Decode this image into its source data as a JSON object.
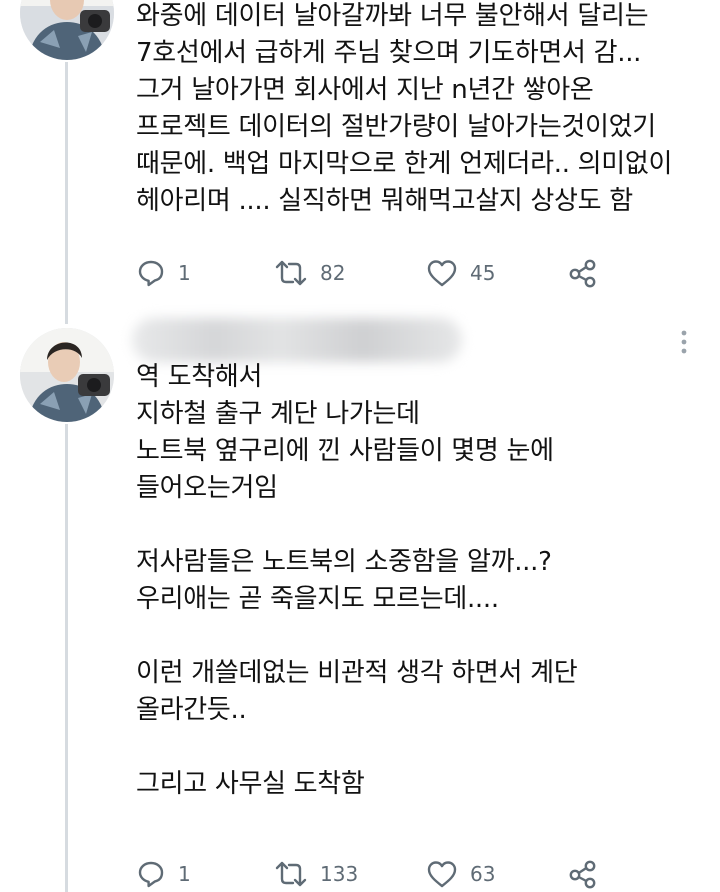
{
  "tweets": [
    {
      "author_name": "",
      "text": "와중에 데이터 날아갈까봐 너무 불안해서 달리는\n7호선에서 급하게 주님 찾으며 기도하면서 감...\n그거 날아가면 회사에서 지난 n년간 쌓아온\n프로젝트 데이터의 절반가량이 날아가는것이었기\n때문에. 백업 마지막으로 한게 언제더라.. 의미없이\n헤아리며 .... 실직하면 뭐해먹고살지 상상도 함",
      "replies": "1",
      "retweets": "82",
      "likes": "45"
    },
    {
      "author_name": "",
      "text": "역 도착해서\n지하철 출구 계단 나가는데\n노트북 옆구리에 낀 사람들이 몇명 눈에\n들어오는거임\n\n저사람들은 노트북의 소중함을 알까...?\n우리애는 곧 죽을지도 모르는데....\n\n이런 개쓸데없는 비관적 생각 하면서 계단\n올라간듯..\n\n그리고 사무실 도착함",
      "replies": "1",
      "retweets": "133",
      "likes": "63"
    }
  ],
  "icons": {
    "reply": "reply-icon",
    "retweet": "retweet-icon",
    "like": "heart-icon",
    "share": "share-icon",
    "more": "more-options-icon"
  },
  "colors": {
    "icon": "#5f6b75",
    "text": "#121212",
    "thread_line": "#d6dbe0"
  }
}
